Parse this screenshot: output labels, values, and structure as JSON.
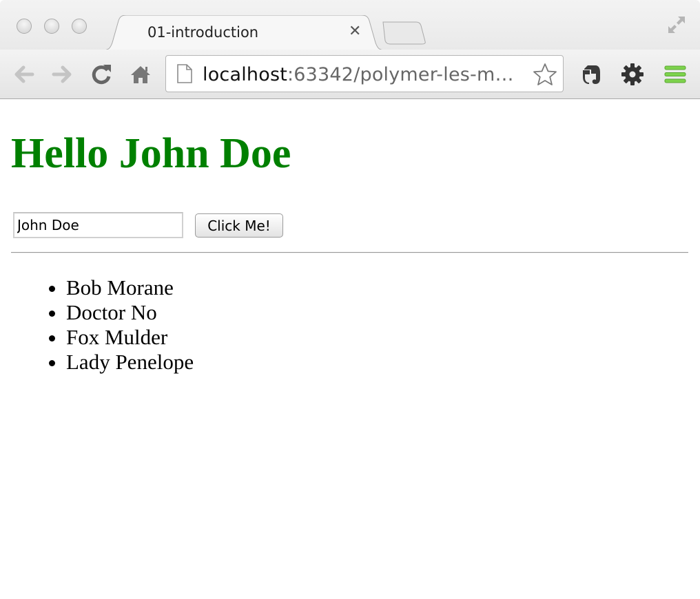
{
  "browser": {
    "tab": {
      "title": "01-introduction",
      "close_label": "✕"
    },
    "address_bar": {
      "host": "localhost",
      "rest": ":63342/polymer-les-m…"
    },
    "icons": {
      "back": "back-arrow-icon",
      "forward": "forward-arrow-icon",
      "reload": "reload-icon",
      "home": "home-icon",
      "page": "page-icon",
      "bookmark": "star-icon",
      "evernote": "evernote-icon",
      "settings": "gear-icon",
      "menu": "hamburger-menu-icon",
      "fullscreen": "fullscreen-icon"
    },
    "colors": {
      "menu_icon": "#7ed34d"
    }
  },
  "page": {
    "heading": "Hello John Doe",
    "heading_color": "#008000",
    "name_input": {
      "value": "John Doe"
    },
    "button_label": "Click Me!",
    "people": [
      "Bob Morane",
      "Doctor No",
      "Fox Mulder",
      "Lady Penelope"
    ]
  }
}
